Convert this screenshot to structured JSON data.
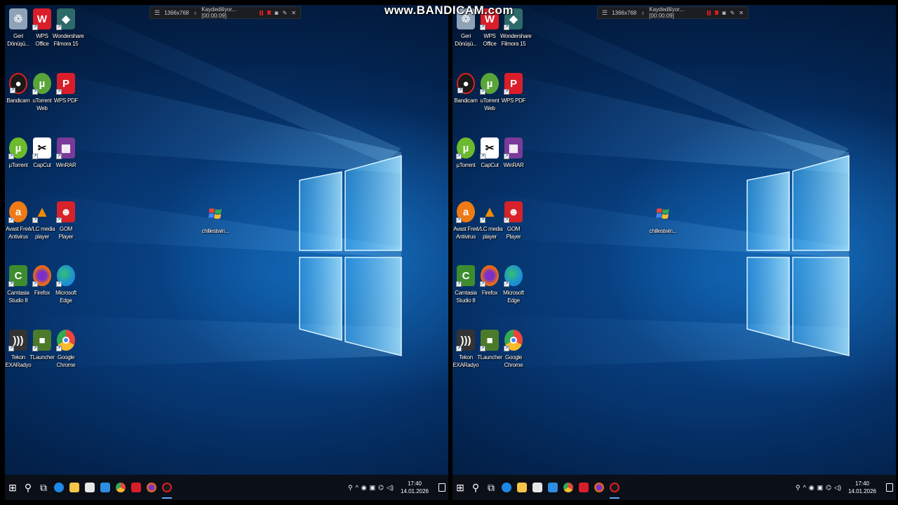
{
  "watermark": "www.BANDICAM.com",
  "recorder": {
    "resolution": "1366x768",
    "status": "Kaydediliyor... [00:00:09]"
  },
  "desktop_icons": [
    {
      "label1": "Geri",
      "label2": "Dönüşü...",
      "icon": "recycle-bin-icon",
      "color": "#8fa3b8"
    },
    {
      "label1": "WPS Office",
      "label2": "",
      "icon": "wps-office-icon",
      "color": "#d91e2a"
    },
    {
      "label1": "Wondershare",
      "label2": "Filmora 15",
      "icon": "filmora-icon",
      "color": "#2d6a6a"
    },
    {
      "label1": "Bandicam",
      "label2": "",
      "icon": "bandicam-icon",
      "color": "#1a1a1a"
    },
    {
      "label1": "uTorrent",
      "label2": "Web",
      "icon": "utorrent-web-icon",
      "color": "#5aa53a"
    },
    {
      "label1": "WPS PDF",
      "label2": "",
      "icon": "wps-pdf-icon",
      "color": "#d91e2a"
    },
    {
      "label1": "µTorrent",
      "label2": "",
      "icon": "utorrent-icon",
      "color": "#6cba2e"
    },
    {
      "label1": "CapCut",
      "label2": "",
      "icon": "capcut-icon",
      "color": "#ffffff"
    },
    {
      "label1": "WinRAR",
      "label2": "",
      "icon": "winrar-icon",
      "color": "#7a3a9a"
    },
    {
      "label1": "Avast Free",
      "label2": "Antivirus",
      "icon": "avast-icon",
      "color": "#f07a14"
    },
    {
      "label1": "VLC media",
      "label2": "player",
      "icon": "vlc-icon",
      "color": "#f08a00"
    },
    {
      "label1": "GOM Player",
      "label2": "",
      "icon": "gom-player-icon",
      "color": "#d8222a"
    },
    {
      "label1": "Camtasia",
      "label2": "Studio 8",
      "icon": "camtasia-icon",
      "color": "#3d8c2e"
    },
    {
      "label1": "Firefox",
      "label2": "",
      "icon": "firefox-icon",
      "color": "#e66a1a"
    },
    {
      "label1": "Microsoft",
      "label2": "Edge",
      "icon": "edge-icon",
      "color": "#1b8fd6"
    },
    {
      "label1": "Tekon",
      "label2": "EXARadyo",
      "icon": "exaradyo-icon",
      "color": "#333333"
    },
    {
      "label1": "TLauncher",
      "label2": "",
      "icon": "tlauncher-icon",
      "color": "#4d7a2a"
    },
    {
      "label1": "Google",
      "label2": "Chrome",
      "icon": "chrome-icon",
      "color": "#e8453c"
    }
  ],
  "middle_icon": {
    "label": "chillestwin...",
    "icon": "windows-xp-logo-icon"
  },
  "taskbar": {
    "start": "start-icon",
    "clock_time": "17:40",
    "clock_date": "14.01.2026"
  }
}
